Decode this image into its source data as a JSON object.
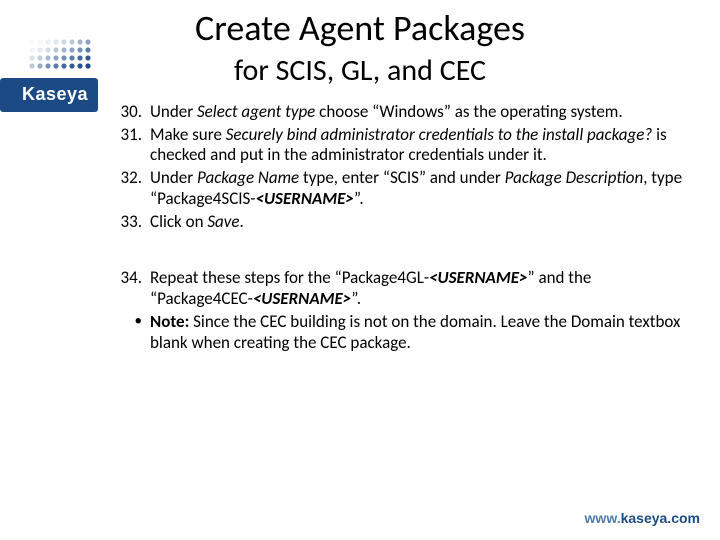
{
  "brand": {
    "name": "Kaseya",
    "url_www": "www.",
    "url_domain": "kaseya.com"
  },
  "title": "Create Agent Packages",
  "subtitle": "for SCIS, GL, and CEC",
  "items": [
    {
      "num": "30.",
      "segments": [
        {
          "t": "Under "
        },
        {
          "t": "Select agent type",
          "italic": true
        },
        {
          "t": " choose “Windows” as the operating system."
        }
      ]
    },
    {
      "num": "31.",
      "segments": [
        {
          "t": "Make sure "
        },
        {
          "t": "Securely bind administrator credentials to the install package?",
          "italic": true
        },
        {
          "t": " is checked and put in the administrator credentials under it."
        }
      ]
    },
    {
      "num": "32.",
      "segments": [
        {
          "t": "Under "
        },
        {
          "t": "Package Name",
          "italic": true
        },
        {
          "t": " type, enter “SCIS” and under "
        },
        {
          "t": "Package Description",
          "italic": true
        },
        {
          "t": ", type “Package4SCIS-"
        },
        {
          "t": "<USERNAME>",
          "italic": true,
          "bold": true
        },
        {
          "t": "”."
        }
      ]
    },
    {
      "num": "33.",
      "segments": [
        {
          "t": "Click on "
        },
        {
          "t": "Save",
          "italic": true
        },
        {
          "t": "."
        }
      ]
    },
    {
      "gap": true
    },
    {
      "num": "34.",
      "segments": [
        {
          "t": "Repeat these steps for the “Package4GL-"
        },
        {
          "t": "<USERNAME>",
          "italic": true,
          "bold": true
        },
        {
          "t": "” and the “Package4CEC-"
        },
        {
          "t": "<USERNAME>",
          "italic": true,
          "bold": true
        },
        {
          "t": "”."
        }
      ]
    },
    {
      "num": "•",
      "note": true,
      "segments": [
        {
          "t": "Note:",
          "bold": true
        },
        {
          "t": " Since the CEC building is not on the domain. Leave the Domain textbox blank when creating the CEC package."
        }
      ]
    }
  ]
}
